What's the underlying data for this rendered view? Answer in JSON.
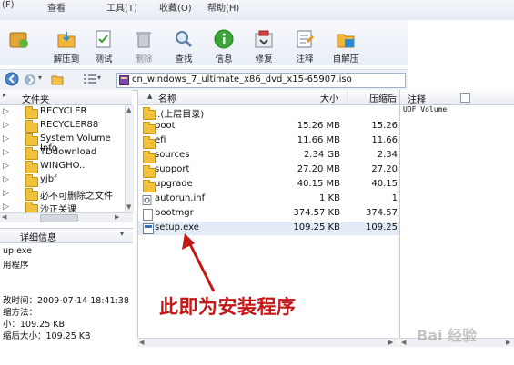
{
  "menu": [
    "(F)",
    "查看",
    "工具(T)",
    "收藏(O)",
    "帮助(H)"
  ],
  "toolbar": {
    "buttons": [
      {
        "label": "",
        "icon": "add-icon"
      },
      {
        "label": "解压到",
        "icon": "extract-icon"
      },
      {
        "label": "测试",
        "icon": "test-icon"
      },
      {
        "label": "删除",
        "icon": "delete-icon"
      },
      {
        "label": "查找",
        "icon": "find-icon"
      },
      {
        "label": "信息",
        "icon": "info-icon"
      },
      {
        "label": "修复",
        "icon": "repair-icon"
      },
      {
        "label": "注释",
        "icon": "comment-icon"
      },
      {
        "label": "自解压",
        "icon": "sfx-icon"
      }
    ]
  },
  "address": {
    "path": "cn_windows_7_ultimate_x86_dvd_x15-65907.iso"
  },
  "tree": {
    "header": "文件夹",
    "items": [
      {
        "label": "RECYCLER",
        "expandable": true
      },
      {
        "label": "RECYCLER88",
        "expandable": true
      },
      {
        "label": "System Volume Info",
        "expandable": true
      },
      {
        "label": "TDdownload",
        "expandable": true
      },
      {
        "label": "WINGHO..",
        "expandable": true
      },
      {
        "label": "yjbf",
        "expandable": true
      },
      {
        "label": "必不可删除之文件",
        "expandable": true
      },
      {
        "label": "沙正关课",
        "expandable": true
      }
    ]
  },
  "details": {
    "header": "详细信息",
    "lines": [
      "up.exe",
      "用程序",
      "改时间：2009-07-14 18:41:38",
      "缩方法：",
      "小：109.25 KB",
      "缩后大小：109.25 KB"
    ]
  },
  "list": {
    "columns": {
      "name": "名称",
      "size": "大小",
      "packed": "压缩后",
      "comment": "注释"
    },
    "rows": [
      {
        "name": "..(上层目录)",
        "size": "",
        "packed": "",
        "type": "folder",
        "selected": false
      },
      {
        "name": "boot",
        "size": "15.26 MB",
        "packed": "15.26",
        "type": "folder",
        "selected": false
      },
      {
        "name": "efi",
        "size": "11.66 MB",
        "packed": "11.66",
        "type": "folder",
        "selected": false
      },
      {
        "name": "sources",
        "size": "2.34 GB",
        "packed": "2.34",
        "type": "folder",
        "selected": false
      },
      {
        "name": "support",
        "size": "27.20 MB",
        "packed": "27.20",
        "type": "folder",
        "selected": false
      },
      {
        "name": "upgrade",
        "size": "40.15 MB",
        "packed": "40.15",
        "type": "folder",
        "selected": false
      },
      {
        "name": "autorun.inf",
        "size": "1 KB",
        "packed": "1",
        "type": "file",
        "selected": false
      },
      {
        "name": "bootmgr",
        "size": "374.57 KB",
        "packed": "374.57",
        "type": "file",
        "selected": false
      },
      {
        "name": "setup.exe",
        "size": "109.25 KB",
        "packed": "109.25",
        "type": "exe",
        "selected": true
      }
    ]
  },
  "comment_text": "UDF Volume",
  "annotation": "此即为安装程序",
  "watermark": "Bai 经验"
}
